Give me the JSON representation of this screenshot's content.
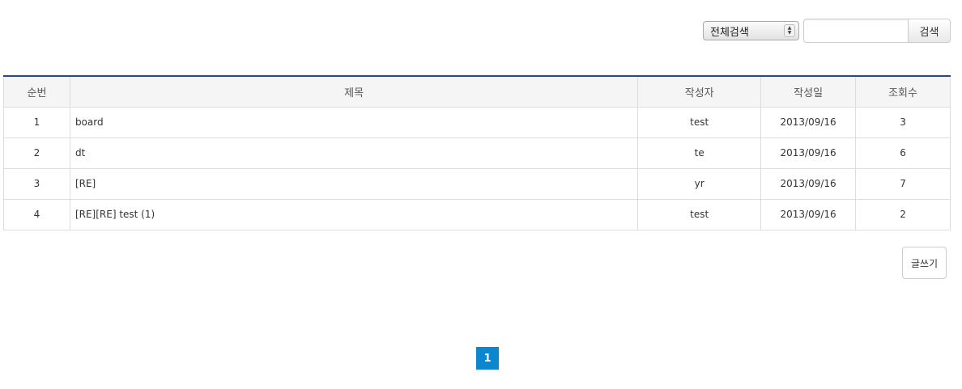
{
  "search": {
    "select_value": "전체검색",
    "input_value": "",
    "input_placeholder": "",
    "button_label": "검색"
  },
  "table": {
    "headers": {
      "no": "순번",
      "title": "제목",
      "author": "작성자",
      "date": "작성일",
      "views": "조회수"
    },
    "rows": [
      {
        "no": "1",
        "title": "board",
        "author": "test",
        "date": "2013/09/16",
        "views": "3"
      },
      {
        "no": "2",
        "title": "dt",
        "author": "te",
        "date": "2013/09/16",
        "views": "6"
      },
      {
        "no": "3",
        "title": "[RE]",
        "author": "yr",
        "date": "2013/09/16",
        "views": "7"
      },
      {
        "no": "4",
        "title": "[RE][RE] test (1)",
        "author": "test",
        "date": "2013/09/16",
        "views": "2"
      }
    ]
  },
  "actions": {
    "write_label": "글쓰기"
  },
  "pagination": {
    "current": "1"
  },
  "colors": {
    "table_top_border": "#274a7d",
    "pagination_active": "#0b87d0",
    "header_bg": "#f5f5f5"
  }
}
